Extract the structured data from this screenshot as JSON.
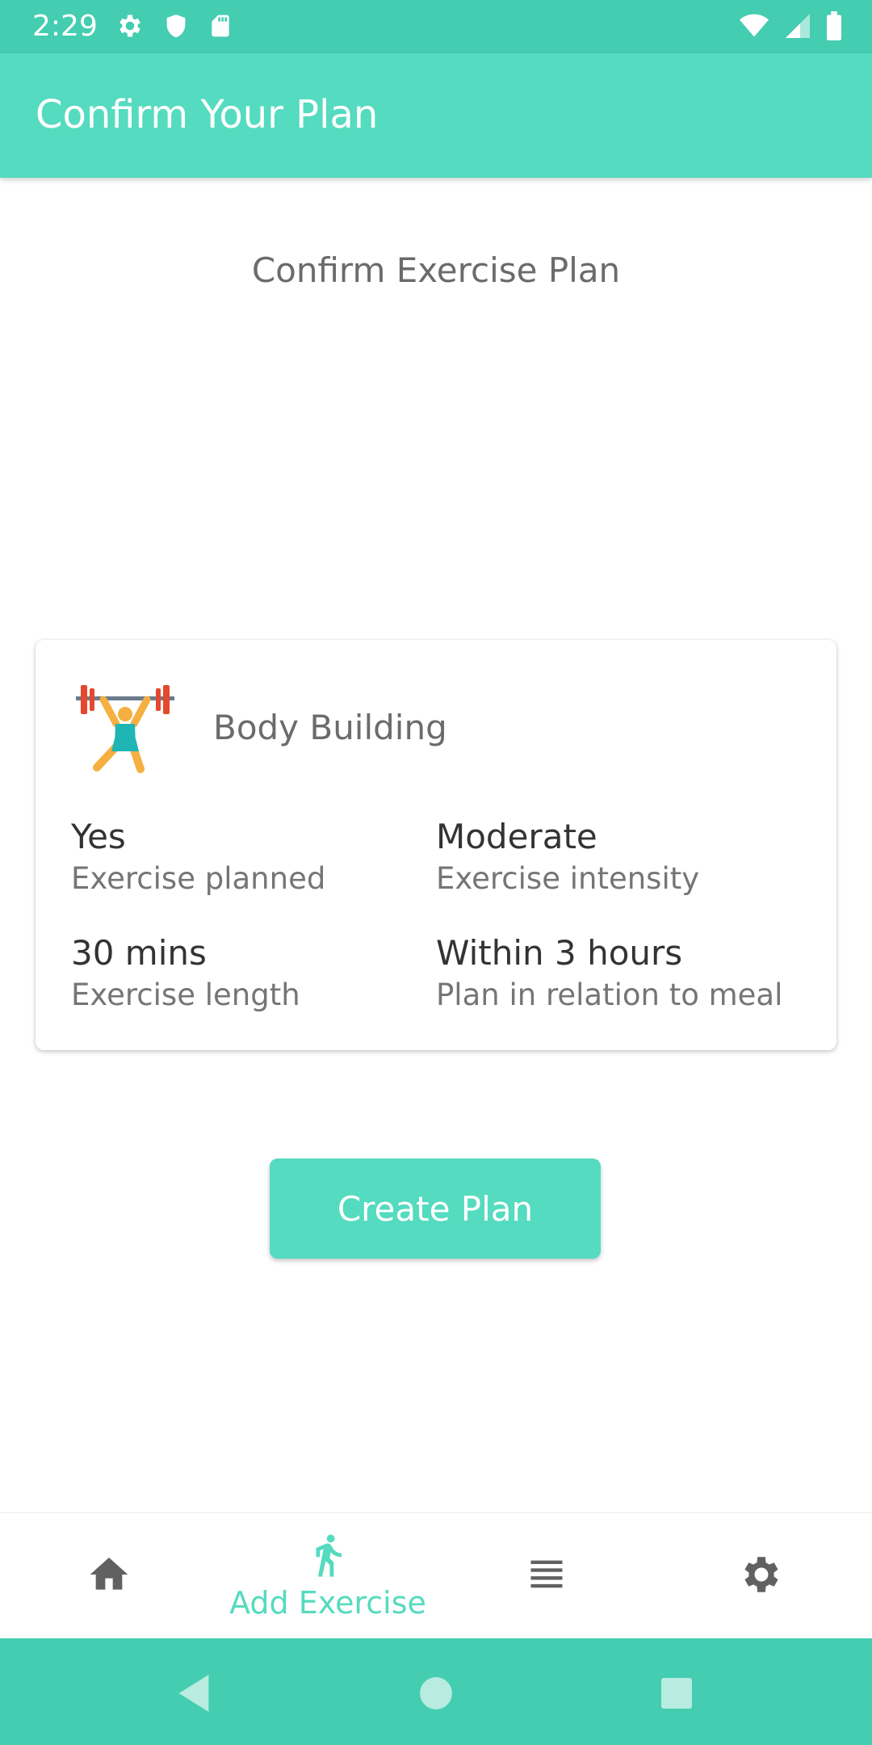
{
  "status_bar": {
    "time": "2:29",
    "icons_left": [
      "gear-icon",
      "shield-icon",
      "sd-card-icon"
    ],
    "icons_right": [
      "wifi-icon",
      "signal-icon",
      "battery-icon"
    ]
  },
  "app_bar": {
    "title": "Confirm Your Plan"
  },
  "main": {
    "heading": "Confirm Exercise Plan",
    "card": {
      "icon": "weightlifter-icon",
      "title": "Body Building",
      "stats": [
        {
          "value": "Yes",
          "label": "Exercise planned"
        },
        {
          "value": "Moderate",
          "label": "Exercise intensity"
        },
        {
          "value": "30 mins",
          "label": "Exercise length"
        },
        {
          "value": "Within 3 hours",
          "label": "Plan in relation to meal"
        }
      ]
    },
    "create_button": "Create Plan"
  },
  "bottom_nav": {
    "items": [
      {
        "icon": "home-icon",
        "label": ""
      },
      {
        "icon": "running-icon",
        "label": "Add Exercise",
        "active": true
      },
      {
        "icon": "list-icon",
        "label": ""
      },
      {
        "icon": "gear-icon",
        "label": ""
      }
    ]
  },
  "colors": {
    "primary": "#55dbbf",
    "primary_dark": "#44cdb1",
    "text_dark": "#333333",
    "text_muted": "#757575"
  }
}
